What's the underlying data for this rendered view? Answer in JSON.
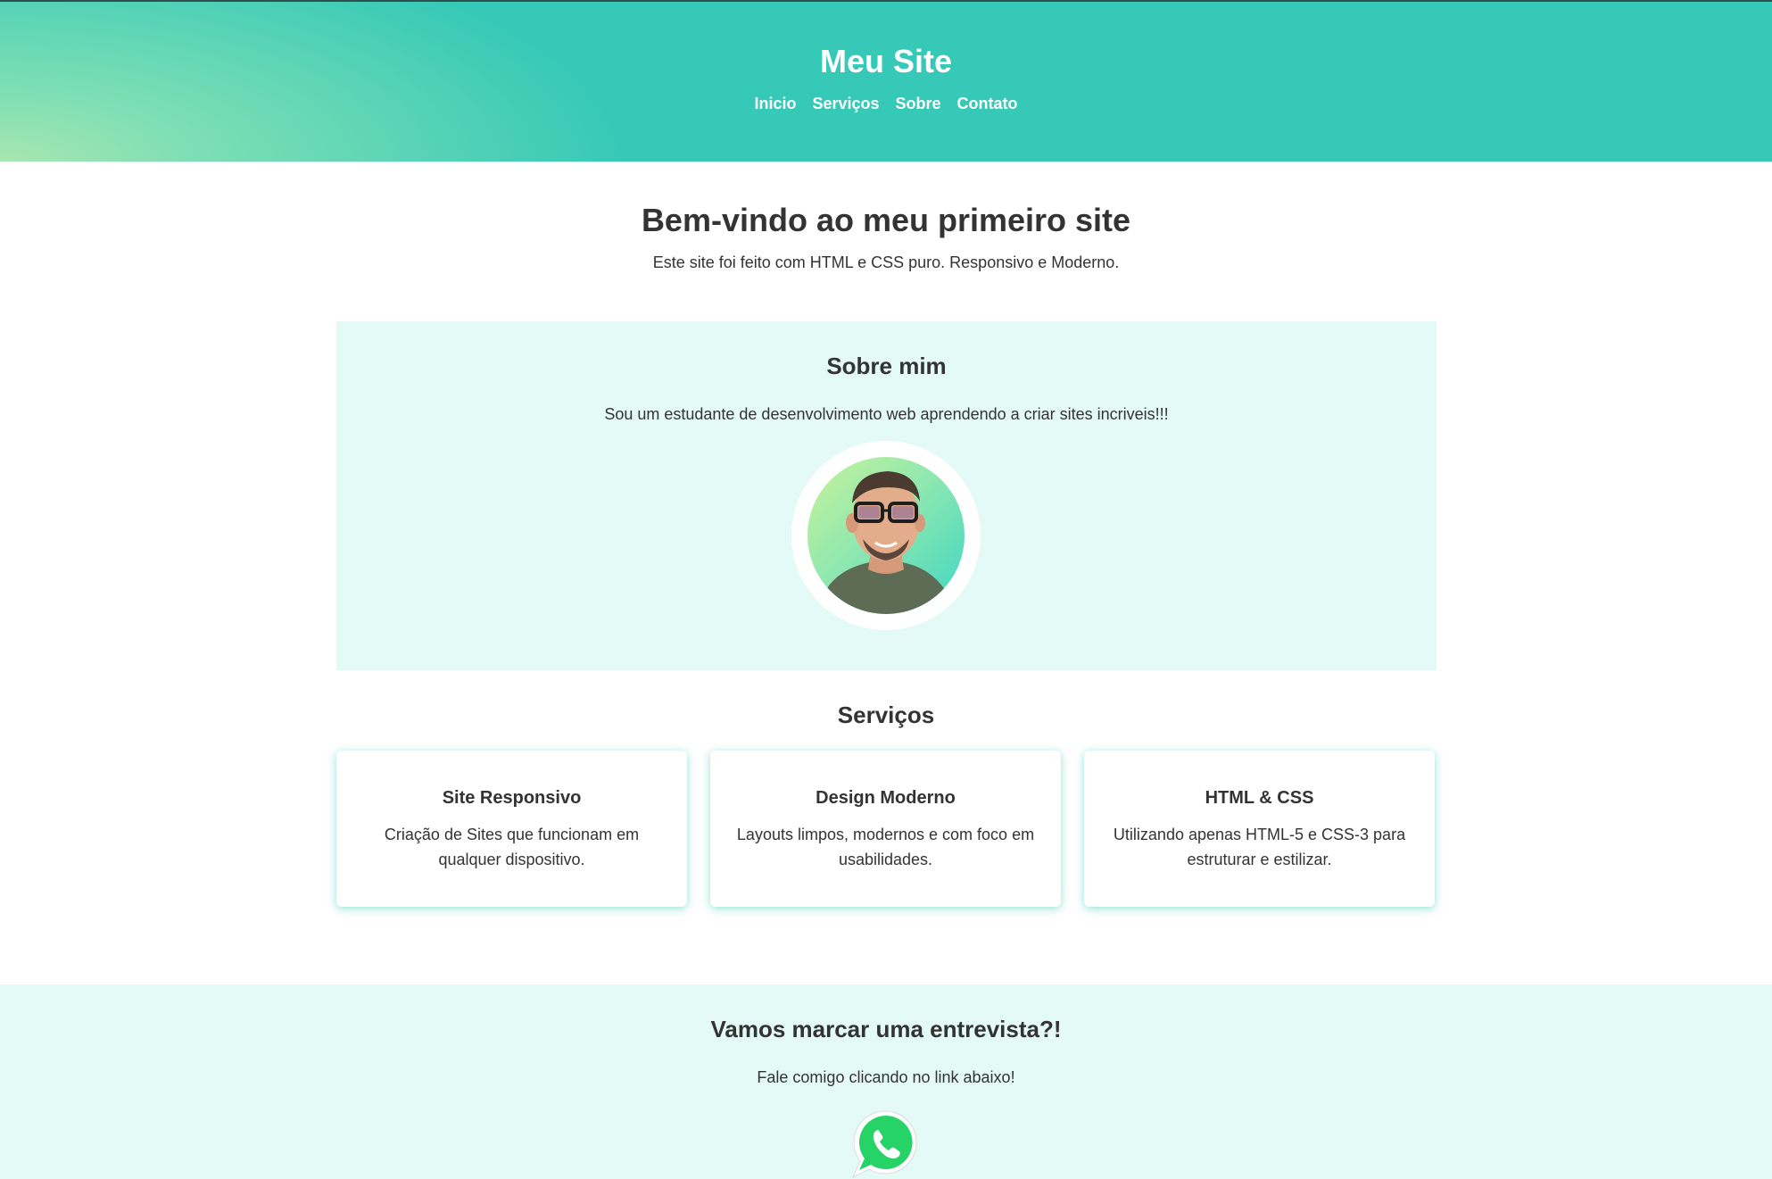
{
  "header": {
    "title": "Meu Site",
    "nav": [
      "Inicio",
      "Serviços",
      "Sobre",
      "Contato"
    ]
  },
  "hero": {
    "title": "Bem-vindo ao meu primeiro site",
    "subtitle": "Este site foi feito com HTML e CSS puro. Responsivo e Moderno."
  },
  "about": {
    "title": "Sobre mim",
    "text": "Sou um estudante de desenvolvimento web aprendendo a criar sites incriveis!!!"
  },
  "services": {
    "title": "Serviços",
    "cards": [
      {
        "title": "Site Responsivo",
        "text": "Criação de Sites que funcionam em qualquer dispositivo."
      },
      {
        "title": "Design Moderno",
        "text": "Layouts limpos, modernos e com foco em usabilidades."
      },
      {
        "title": "HTML & CSS",
        "text": "Utilizando apenas HTML-5 e CSS-3 para estruturar e estilizar."
      }
    ]
  },
  "contact": {
    "title": "Vamos marcar uma entrevista?!",
    "text": "Fale comigo clicando no link abaixo!"
  },
  "icons": {
    "avatar": "profile-photo",
    "contact_link": "whatsapp-icon"
  },
  "colors": {
    "primary": "#36c9b7",
    "light_section": "#e3faf6",
    "text": "#333333",
    "whatsapp": "#25d366"
  }
}
